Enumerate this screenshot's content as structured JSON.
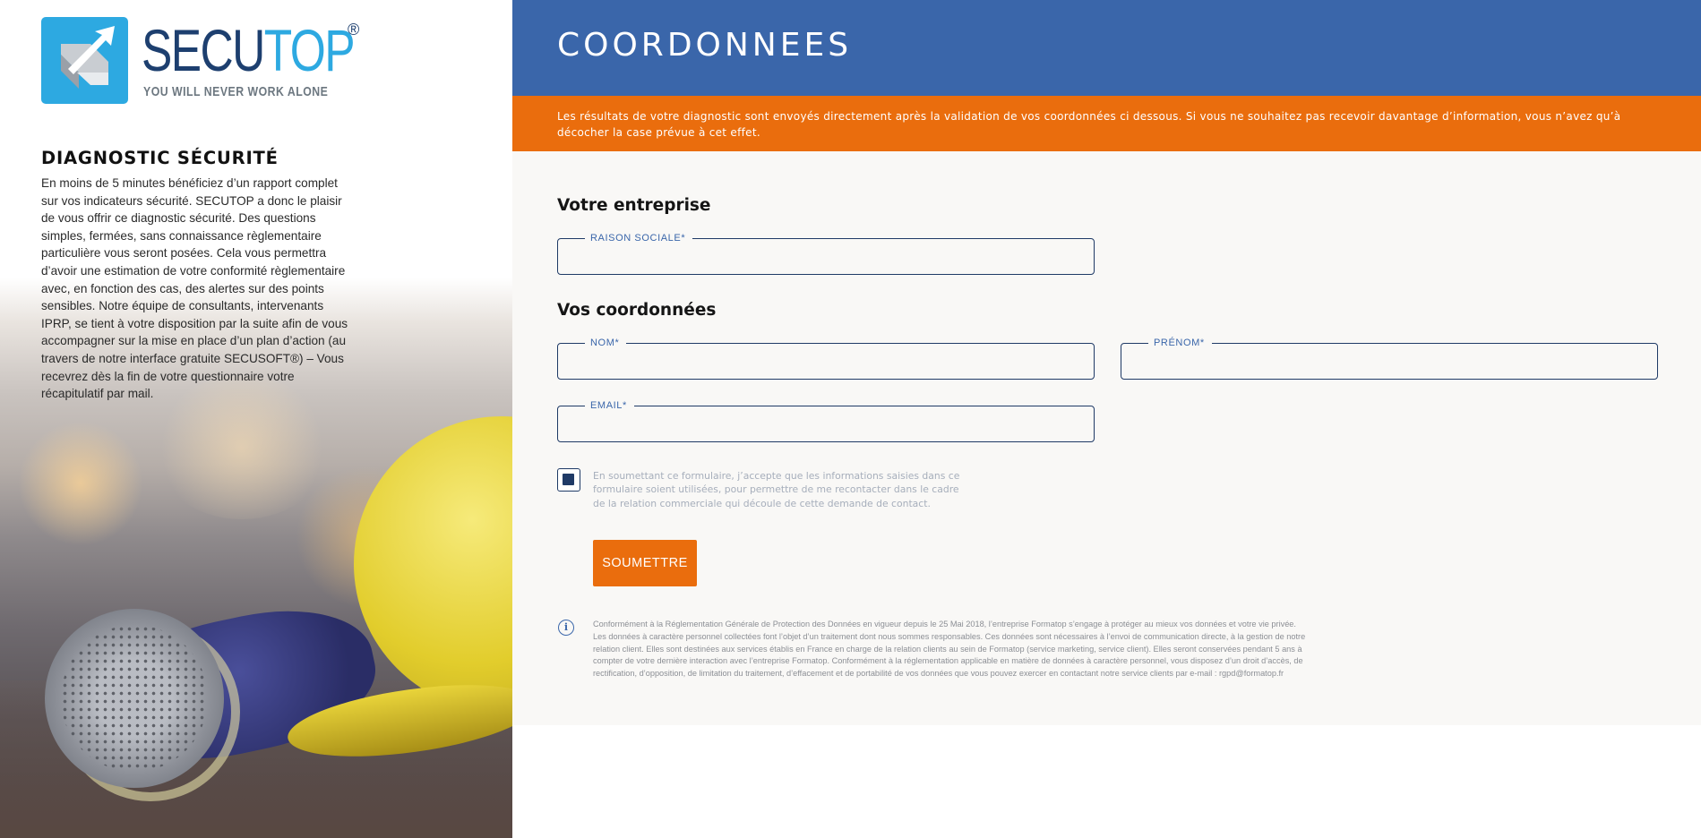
{
  "brand": {
    "name_part1": "SECU",
    "name_part2": "TOP",
    "registered": "®",
    "tagline": "YOU WILL NEVER WORK ALONE",
    "colors": {
      "primary": "#2da9e1",
      "dark": "#1d3f6f"
    }
  },
  "intro": {
    "title": "DIAGNOSTIC SÉCURITÉ",
    "text": "En moins de 5 minutes bénéficiez d’un rapport complet sur vos indicateurs sécurité. SECUTOP a donc le plaisir de vous offrir ce diagnostic sécurité. Des questions simples, fermées, sans connaissance règlementaire particulière vous seront posées. Cela vous permettra d’avoir une estimation de votre conformité règlementaire avec, en fonction des cas, des alertes sur des points sensibles. Notre équipe de consultants, intervenants IPRP, se tient à votre disposition par la suite afin de vous accompagner sur la mise en place d’un plan d’action (au travers de notre interface gratuite SECUSOFT®) – Vous recevrez dès la fin de votre questionnaire votre récapitulatif par mail."
  },
  "header": {
    "title": "COORDONNEES",
    "color": "#3a66aa"
  },
  "banner": {
    "text": "Les résultats de votre diagnostic sont envoyés directement après la validation de vos coordonnées ci dessous. Si vous ne souhaitez pas recevoir davantage d’information, vous n’avez qu’à décocher la case prévue à cet effet.",
    "color": "#ea6d0d"
  },
  "form": {
    "company_section": "Votre entreprise",
    "company_field": {
      "label": "RAISON SOCIALE*",
      "value": ""
    },
    "contact_section": "Vos coordonnées",
    "lastname_field": {
      "label": "NOM*",
      "value": ""
    },
    "firstname_field": {
      "label": "PRÉNOM*",
      "value": ""
    },
    "email_field": {
      "label": "EMAIL*",
      "value": ""
    },
    "consent": {
      "checked": true,
      "text": "En soumettant ce formulaire, j’accepte que les informations saisies dans ce formulaire soient utilisées, pour permettre de me recontacter dans le cadre de la relation commerciale qui découle de cette demande de contact."
    },
    "submit_label": "SOUMETTRE",
    "info_icon": "info-circle-icon",
    "legal": "Conformément à la Réglementation Générale de Protection des Données en vigueur depuis le 25 Mai 2018, l’entreprise Formatop s’engage à protéger au mieux vos données et votre vie privée. Les données à caractère personnel collectées font l’objet d’un traitement dont nous sommes responsables. Ces données sont nécessaires à l’envoi de communication directe, à la gestion de notre relation client. Elles sont destinées aux services établis en France en charge de la relation clients au sein de Formatop (service marketing, service client). Elles seront conservées pendant 5 ans à compter de votre dernière interaction avec l’entreprise Formatop. Conformément à la réglementation applicable en matière de données à caractère personnel, vous disposez d’un droit d’accès, de rectification, d’opposition, de limitation du traitement, d’effacement et de portabilité de vos données que vous pouvez exercer en contactant notre service clients par e-mail : rgpd@formatop.fr"
  }
}
